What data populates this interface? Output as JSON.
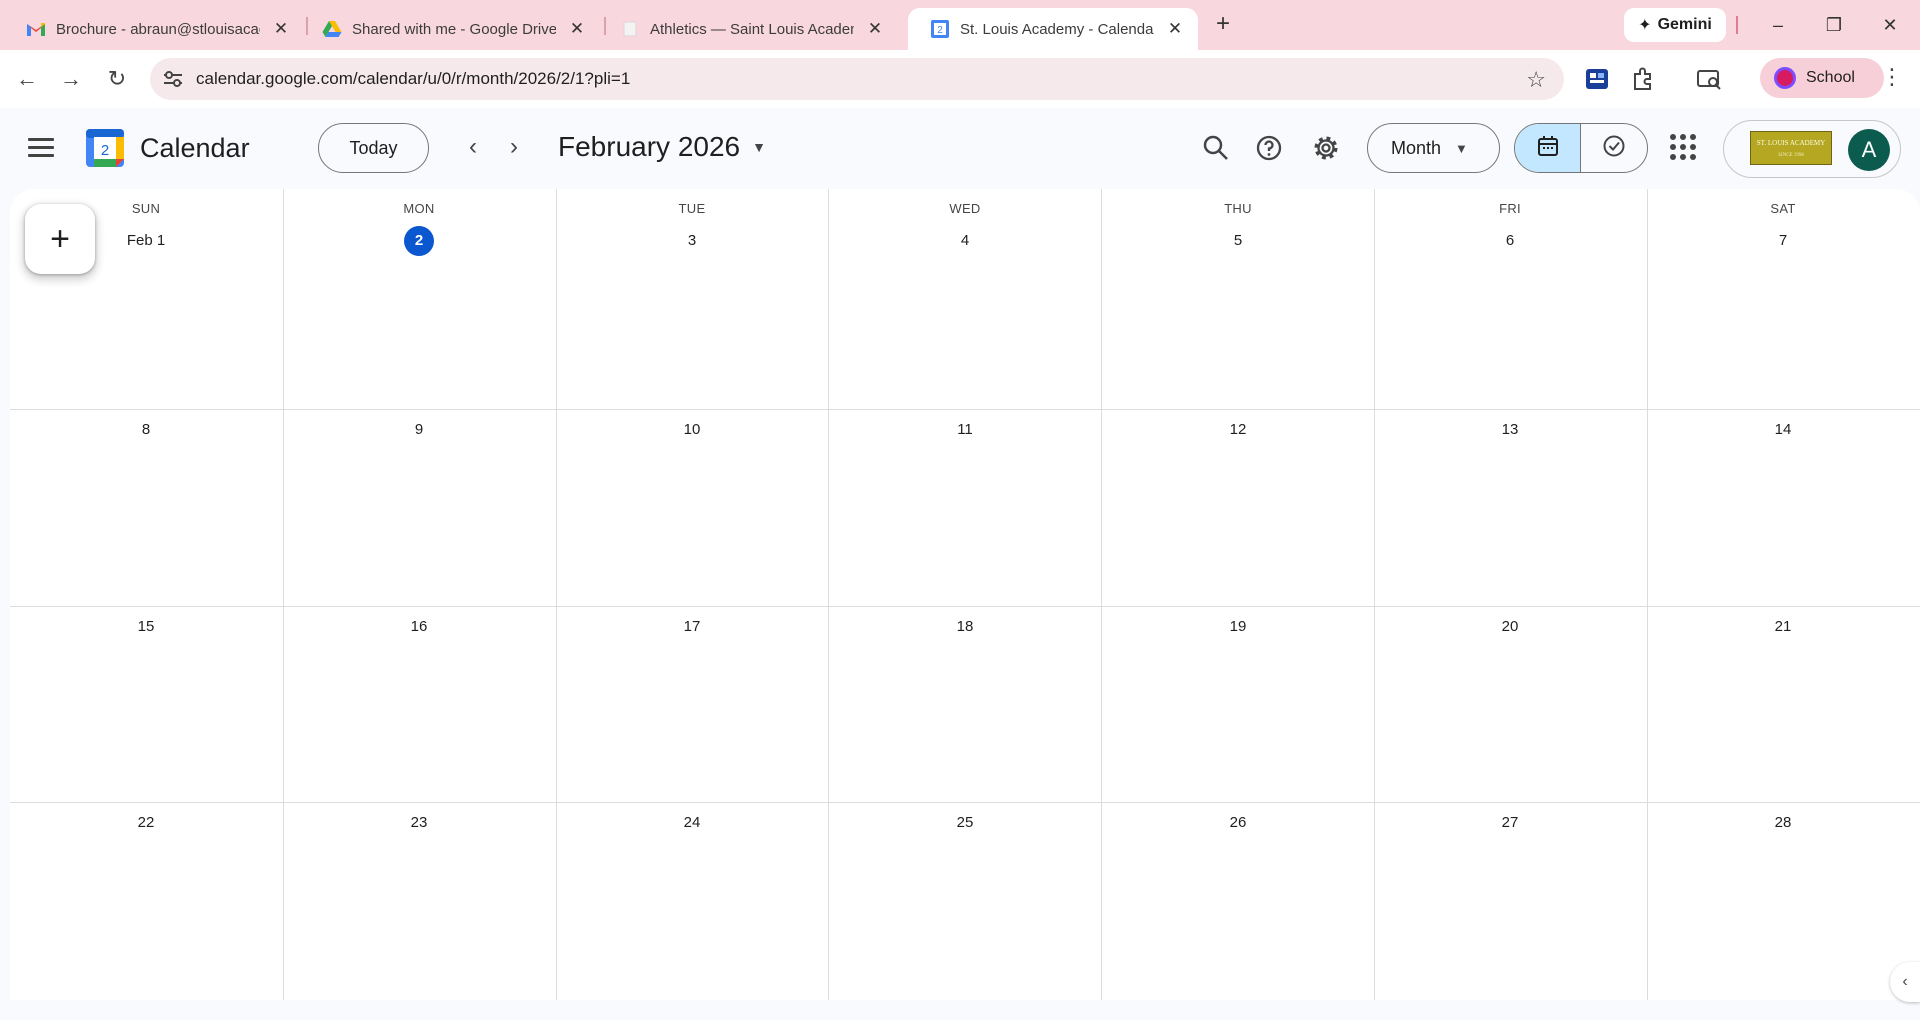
{
  "browser": {
    "tabs": [
      {
        "title": "Brochure - abraun@stlouisacad",
        "icon": "gmail-icon",
        "active": false
      },
      {
        "title": "Shared with me - Google Drive",
        "icon": "google-drive-icon",
        "active": false
      },
      {
        "title": "Athletics — Saint Louis Academ",
        "icon": "blank-page-icon",
        "active": false
      },
      {
        "title": "St. Louis Academy - Calendar -  ",
        "icon": "google-calendar-icon",
        "active": true
      }
    ],
    "new_tab_label": "+",
    "gemini_label": "Gemini",
    "url": "calendar.google.com/calendar/u/0/r/month/2026/2/1?pli=1",
    "profile_label": "School"
  },
  "calendar": {
    "app_name": "Calendar",
    "logo_day": "2",
    "today_label": "Today",
    "month_title": "February 2026",
    "view_label": "Month",
    "org_logo_text": "ST. LOUIS ACADEMY",
    "org_logo_sub": "SINCE 1998",
    "avatar_letter": "A",
    "weekdays": [
      "SUN",
      "MON",
      "TUE",
      "WED",
      "THU",
      "FRI",
      "SAT"
    ],
    "weeks": [
      [
        "Feb 1",
        "2",
        "3",
        "4",
        "5",
        "6",
        "7"
      ],
      [
        "8",
        "9",
        "10",
        "11",
        "12",
        "13",
        "14"
      ],
      [
        "15",
        "16",
        "17",
        "18",
        "19",
        "20",
        "21"
      ],
      [
        "22",
        "23",
        "24",
        "25",
        "26",
        "27",
        "28"
      ]
    ],
    "today": "2",
    "create_label": "+"
  },
  "colors": {
    "tabstrip_bg": "#f8d7de",
    "accent_blue": "#0b57d0",
    "selected_view": "#c2e7ff",
    "avatar_bg": "#0b5b4f"
  }
}
